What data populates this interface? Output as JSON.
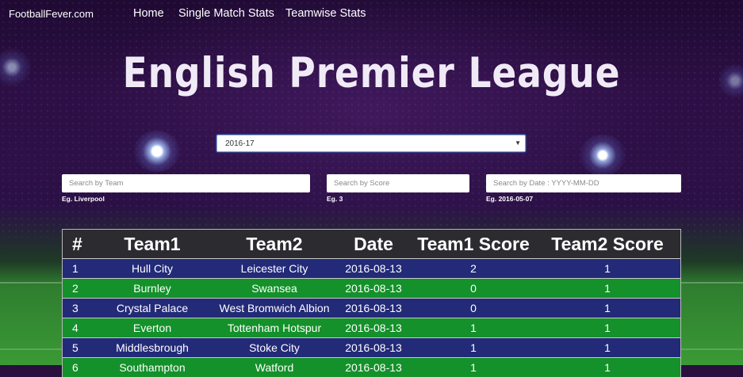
{
  "nav": {
    "brand": "FootballFever.com",
    "links": [
      "Home",
      "Single Match Stats",
      "Teamwise Stats"
    ]
  },
  "title": "English Premier League",
  "season_select": {
    "value": "2016-17"
  },
  "filters": {
    "team": {
      "placeholder": "Search by Team",
      "hint": "Eg. Liverpool"
    },
    "score": {
      "placeholder": "Search by Score",
      "hint": "Eg. 3"
    },
    "date": {
      "placeholder": "Search by Date : YYYY-MM-DD",
      "hint": "Eg. 2016-05-07"
    }
  },
  "table": {
    "headers": [
      "#",
      "Team1",
      "Team2",
      "Date",
      "Team1 Score",
      "Team2 Score"
    ],
    "rows": [
      [
        "1",
        "Hull City",
        "Leicester City",
        "2016-08-13",
        "2",
        "1"
      ],
      [
        "2",
        "Burnley",
        "Swansea",
        "2016-08-13",
        "0",
        "1"
      ],
      [
        "3",
        "Crystal Palace",
        "West Bromwich Albion",
        "2016-08-13",
        "0",
        "1"
      ],
      [
        "4",
        "Everton",
        "Tottenham Hotspur",
        "2016-08-13",
        "1",
        "1"
      ],
      [
        "5",
        "Middlesbrough",
        "Stoke City",
        "2016-08-13",
        "1",
        "1"
      ],
      [
        "6",
        "Southampton",
        "Watford",
        "2016-08-13",
        "1",
        "1"
      ]
    ]
  },
  "colors": {
    "row_blue": "#232a78",
    "row_green": "#14912a",
    "header": "#2c2c30"
  }
}
